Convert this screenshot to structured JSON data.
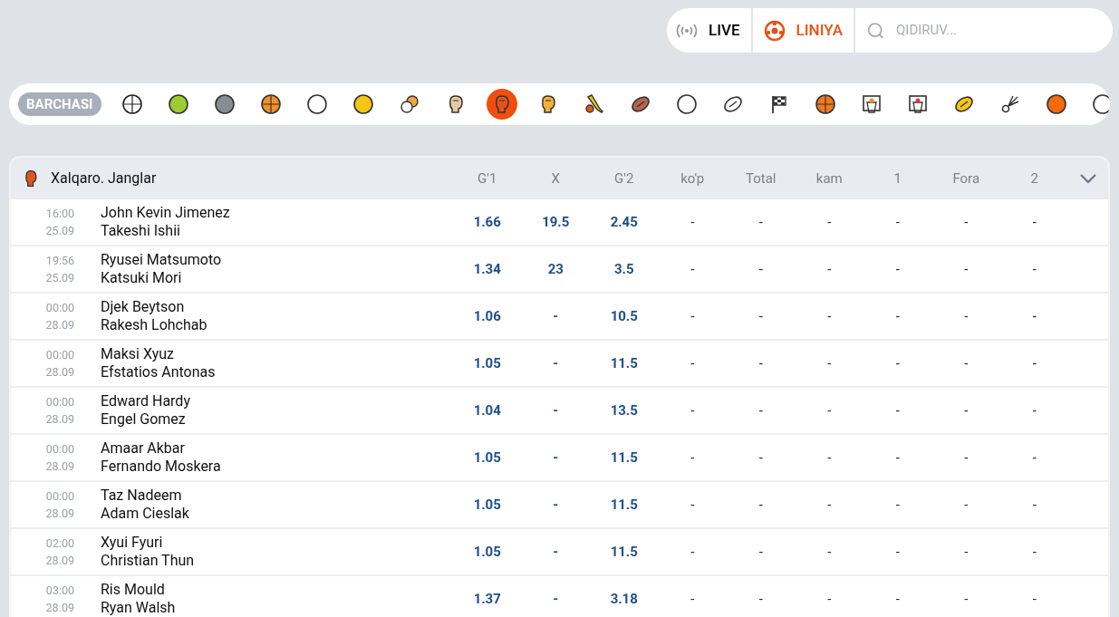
{
  "top_nav": {
    "tabs": [
      {
        "label": "LIVE",
        "selected": false
      },
      {
        "label": "LINIYA",
        "selected": true
      }
    ],
    "search": {
      "placeholder": "QIDIRUV..."
    }
  },
  "sports_bar": {
    "all_label": "BARCHASI",
    "all_selected": false,
    "sports": [
      {
        "selected": false
      },
      {
        "selected": false
      },
      {
        "selected": false
      },
      {
        "selected": false
      },
      {
        "selected": false
      },
      {
        "selected": false
      },
      {
        "selected": false
      },
      {
        "selected": false
      },
      {
        "selected": true
      },
      {
        "selected": false
      },
      {
        "selected": false
      },
      {
        "selected": false
      },
      {
        "selected": false
      },
      {
        "selected": false
      },
      {
        "selected": false
      },
      {
        "selected": false
      },
      {
        "selected": false
      },
      {
        "selected": false
      },
      {
        "selected": false
      },
      {
        "selected": false
      },
      {
        "selected": false
      },
      {
        "selected": false
      }
    ]
  },
  "league": {
    "title": "Xalqaro. Janglar",
    "columns": [
      "G'1",
      "X",
      "G'2",
      "ko'p",
      "Total",
      "kam",
      "1",
      "Fora",
      "2"
    ],
    "rows": [
      {
        "time": "16:00",
        "date": "25.09",
        "team_1": "John Kevin Jimenez",
        "team_2": "Takeshi Ishii",
        "odds": [
          "1.66",
          "19.5",
          "2.45",
          "-",
          "-",
          "-",
          "-",
          "-",
          "-"
        ]
      },
      {
        "time": "19:56",
        "date": "25.09",
        "team_1": "Ryusei Matsumoto",
        "team_2": "Katsuki Mori",
        "odds": [
          "1.34",
          "23",
          "3.5",
          "-",
          "-",
          "-",
          "-",
          "-",
          "-"
        ]
      },
      {
        "time": "00:00",
        "date": "28.09",
        "team_1": "Djek Beytson",
        "team_2": "Rakesh Lohchab",
        "odds": [
          "1.06",
          "-",
          "10.5",
          "-",
          "-",
          "-",
          "-",
          "-",
          "-"
        ]
      },
      {
        "time": "00:00",
        "date": "28.09",
        "team_1": "Maksi Xyuz",
        "team_2": "Efstatios Antonas",
        "odds": [
          "1.05",
          "-",
          "11.5",
          "-",
          "-",
          "-",
          "-",
          "-",
          "-"
        ]
      },
      {
        "time": "00:00",
        "date": "28.09",
        "team_1": "Edward Hardy",
        "team_2": "Engel Gomez",
        "odds": [
          "1.04",
          "-",
          "13.5",
          "-",
          "-",
          "-",
          "-",
          "-",
          "-"
        ]
      },
      {
        "time": "00:00",
        "date": "28.09",
        "team_1": "Amaar Akbar",
        "team_2": "Fernando Moskera",
        "odds": [
          "1.05",
          "-",
          "11.5",
          "-",
          "-",
          "-",
          "-",
          "-",
          "-"
        ]
      },
      {
        "time": "00:00",
        "date": "28.09",
        "team_1": "Taz Nadeem",
        "team_2": "Adam Cieslak",
        "odds": [
          "1.05",
          "-",
          "11.5",
          "-",
          "-",
          "-",
          "-",
          "-",
          "-"
        ]
      },
      {
        "time": "02:00",
        "date": "28.09",
        "team_1": "Xyui Fyuri",
        "team_2": "Christian Thun",
        "odds": [
          "1.05",
          "-",
          "11.5",
          "-",
          "-",
          "-",
          "-",
          "-",
          "-"
        ]
      },
      {
        "time": "03:00",
        "date": "28.09",
        "team_1": "Ris Mould",
        "team_2": "Ryan Walsh",
        "odds": [
          "1.37",
          "-",
          "3.18",
          "-",
          "-",
          "-",
          "-",
          "-",
          "-"
        ]
      }
    ]
  }
}
